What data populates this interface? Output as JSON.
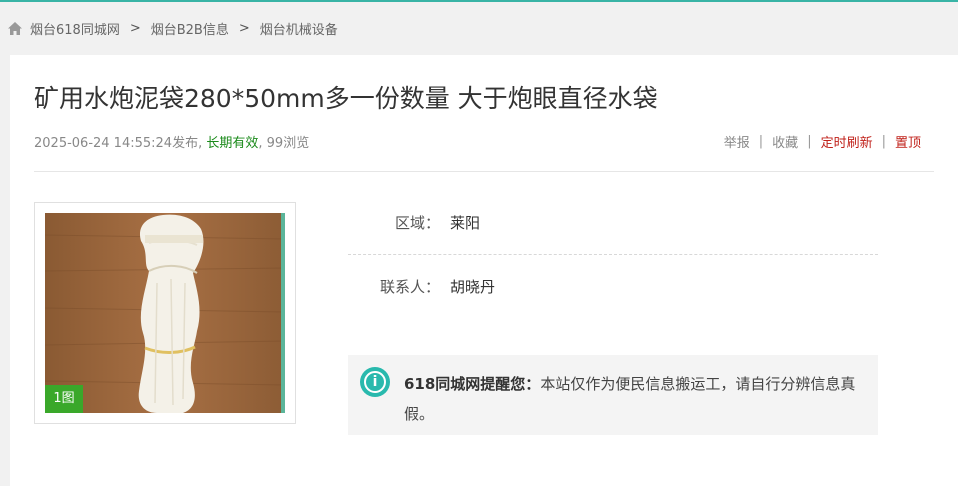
{
  "breadcrumb": {
    "items": [
      "烟台618同城网",
      "烟台B2B信息",
      "烟台机械设备"
    ],
    "separator": ">"
  },
  "listing": {
    "title": "矿用水炮泥袋280*50mm多一份数量 大于炮眼直径水袋",
    "published": "2025-06-24 14:55:24发布",
    "sep1": ",",
    "validity": "长期有效",
    "sep2": ",",
    "views": "99浏览"
  },
  "actions": {
    "report": "举报",
    "favorite": "收藏",
    "auto_refresh": "定时刷新",
    "pin_top": "置顶",
    "divider": "|"
  },
  "photo": {
    "count_label": "1图"
  },
  "fields": {
    "region_label": "区域：",
    "region_value": "莱阳",
    "contact_label": "联系人：",
    "contact_value": "胡晓丹"
  },
  "notice": {
    "icon": "info-icon",
    "icon_glyph": "i",
    "lead": "618同城网提醒您：",
    "body": "本站仅作为便民信息搬运工，请自行分辨信息真假。"
  },
  "colors": {
    "accent": "#29b9ad",
    "valid_green": "#1a8a1a",
    "action_red": "#c0221b",
    "photo_badge": "#3aa82a"
  }
}
